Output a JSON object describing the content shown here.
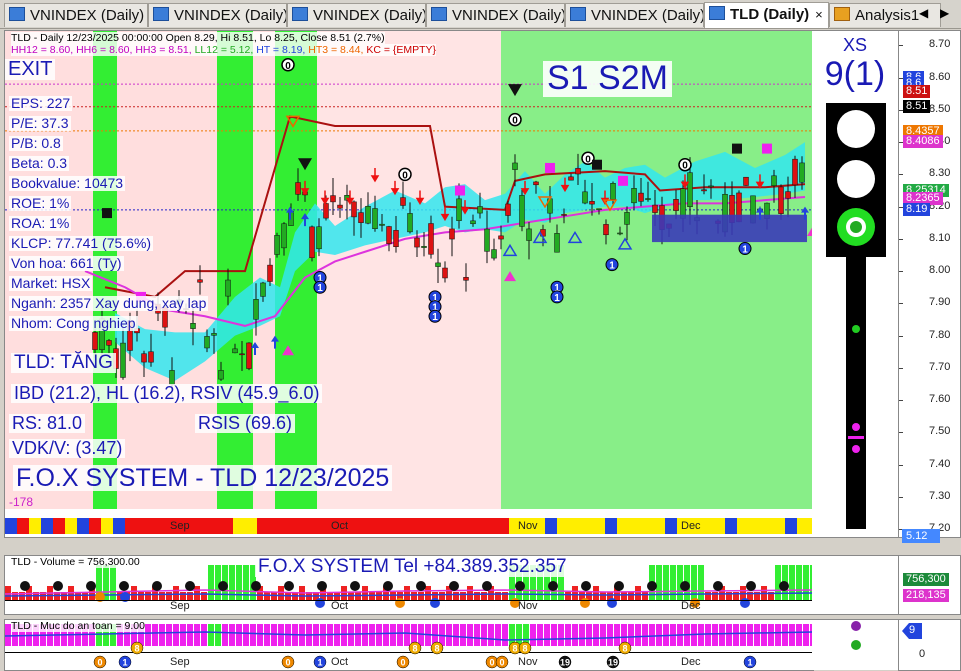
{
  "tabs": [
    {
      "label": "VNINDEX (Daily)"
    },
    {
      "label": "VNINDEX (Daily)"
    },
    {
      "label": "VNINDEX (Daily)"
    },
    {
      "label": "VNINDEX (Daily)"
    },
    {
      "label": "VNINDEX (Daily)"
    },
    {
      "label": "TLD (Daily)"
    },
    {
      "label": "Analysis1"
    }
  ],
  "tab_close": "×",
  "nav_prev": "◀",
  "nav_next": "▶",
  "header": {
    "line1": "TLD - Daily 12/23/2025 00:00:00 Open 8.29, Hi 8.51, Lo 8.25, Close 8.51 (2.7%)",
    "line2_parts": [
      "HH12 = 8.60, ",
      "HH6 = 8.60, ",
      "HH3 = 8.51, ",
      "LL12 = 5.12, ",
      "HT = 8.19, ",
      "HT3 = 8.44, ",
      "KC = {EMPTY}"
    ]
  },
  "exit_label": "EXIT",
  "stats": [
    "EPS: 227",
    "P/E: 37.3",
    "P/B: 0.8",
    "Beta: 0.3",
    "Bookvalue: 10473",
    "ROE: 1%",
    "ROA: 1%",
    "KLCP: 77.741 (75.6%)",
    "Von hoa: 661 (Ty)",
    "Market: HSX",
    "Nganh: 2357 Xay dung, xay lap",
    "Nhom: Cong nghiep"
  ],
  "trend_label": "TLD: TĂNG",
  "ibd_label": "IBD (21.2), HL (16.2), RSIV (45.9_6.0)",
  "rs_label": "RS: 81.0",
  "rsis_label": "RSIS (69.6)",
  "vdk_label": "VDK/V:  (3.47)",
  "system_title": "F.O.X SYSTEM - TLD 12/23/2025",
  "neg_value": "-178",
  "signal_label": "S1  S2M",
  "xs_label": "XS",
  "xs_value": "9(1)",
  "price_axis": {
    "ticks": [
      "8.70",
      "8.60",
      "8.50",
      "8.40",
      "8.30",
      "8.20",
      "8.10",
      "8.00",
      "7.90",
      "7.80",
      "7.70",
      "7.60",
      "7.50",
      "7.40",
      "7.30",
      "7.20"
    ],
    "tags": [
      {
        "text": "8.6",
        "color": "#2244dd",
        "value": 8.6
      },
      {
        "text": "8.6",
        "color": "#2244dd",
        "value": 8.58
      },
      {
        "text": "8.51",
        "color": "#cc1111",
        "value": 8.555
      },
      {
        "text": "8.51",
        "color": "#000000",
        "value": 8.51
      },
      {
        "text": "8.4357",
        "color": "#ee7700",
        "value": 8.43
      },
      {
        "text": "8.4086",
        "color": "#dd33cc",
        "value": 8.4
      },
      {
        "text": "8.25314",
        "color": "#22aa44",
        "value": 8.25
      },
      {
        "text": "8.2365",
        "color": "#dd33cc",
        "value": 8.225
      },
      {
        "text": "8.19",
        "color": "#2244dd",
        "value": 8.19
      }
    ],
    "low_tag": "5.12"
  },
  "months": [
    "Sep",
    "Oct",
    "Nov",
    "Dec"
  ],
  "volume": {
    "header": "TLD - Volume = 756,300.00",
    "tel": "F.O.X SYSTEM Tel +84.389.352.357",
    "tag1": "756,300",
    "tag2": "218,135"
  },
  "safety": {
    "header": "TLD - Muc do an toan = 9.00",
    "tag": "9",
    "zero": "0",
    "markers": [
      "0",
      "1",
      "8",
      "0",
      "1",
      "0",
      "8",
      "8",
      "0",
      "0",
      "8",
      "8",
      "19",
      "19",
      "8",
      "1"
    ]
  },
  "chart_data": {
    "type": "candlestick",
    "title": "TLD - Daily 12/23/2025",
    "x_months": [
      "Sep",
      "Oct",
      "Nov",
      "Dec"
    ],
    "ylim": [
      7.2,
      8.72
    ],
    "last": {
      "open": 8.29,
      "high": 8.51,
      "low": 8.25,
      "close": 8.51,
      "change_pct": 2.7
    }
  }
}
